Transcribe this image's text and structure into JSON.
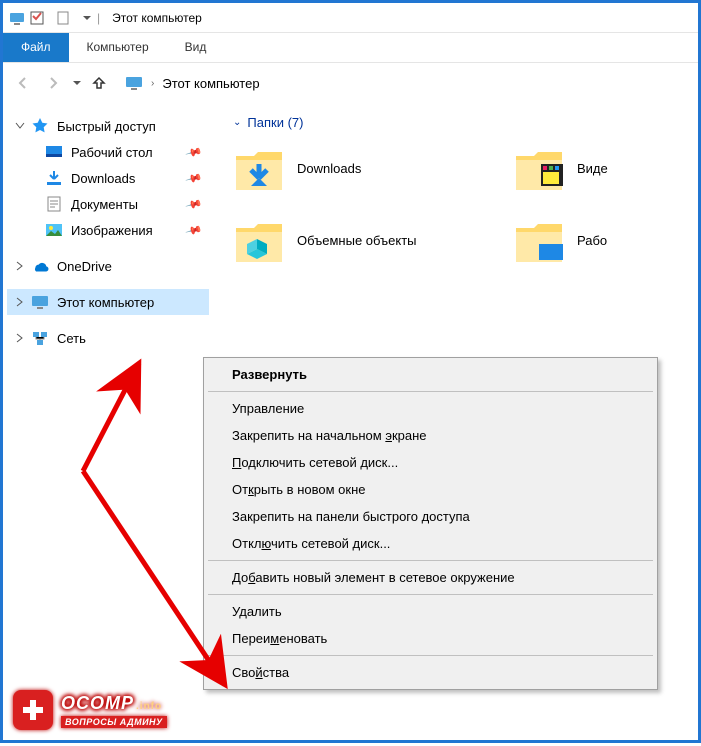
{
  "titlebar": {
    "title": "Этот компьютер"
  },
  "ribbon": {
    "file": "Файл",
    "tab1": "Компьютер",
    "tab2": "Вид"
  },
  "breadcrumb": {
    "text": "Этот компьютер"
  },
  "tree": {
    "quick_access": "Быстрый доступ",
    "desktop": "Рабочий стол",
    "downloads": "Downloads",
    "documents": "Документы",
    "pictures": "Изображения",
    "onedrive": "OneDrive",
    "this_pc": "Этот компьютер",
    "network": "Сеть"
  },
  "main": {
    "group_header": "Папки (7)",
    "folder_downloads": "Downloads",
    "folder_3d": "Объемные объекты",
    "folder_videos": "Виде",
    "folder_desktop2": "Рабо"
  },
  "context_menu": {
    "expand": "Развернуть",
    "manage": "Управление",
    "pin_start_pre": "Закрепить на начальном ",
    "pin_start_u": "э",
    "pin_start_post": "кране",
    "map_drive_pre": "",
    "map_drive_u": "П",
    "map_drive_post": "одключить сетевой диск...",
    "open_new_pre": "От",
    "open_new_u": "к",
    "open_new_post": "рыть в новом окне",
    "pin_qa": "Закрепить на панели быстрого доступа",
    "disconnect_pre": "Откл",
    "disconnect_u": "ю",
    "disconnect_post": "чить сетевой диск...",
    "add_net_pre": "До",
    "add_net_u": "б",
    "add_net_post": "авить новый элемент в сетевое окружение",
    "delete": "Удалить",
    "rename_pre": "Переи",
    "rename_u": "м",
    "rename_post": "еновать",
    "properties_pre": "Сво",
    "properties_u": "й",
    "properties_post": "ства"
  },
  "watermark": {
    "brand": "OCOMP",
    "suffix": ".info",
    "tagline": "ВОПРОСЫ АДМИНУ"
  }
}
